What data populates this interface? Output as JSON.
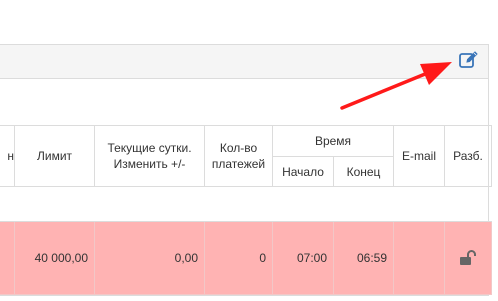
{
  "toolbar": {
    "edit_icon": "edit-icon"
  },
  "table": {
    "columns": {
      "partial": "н",
      "limit": "Лимит",
      "current_day": "Текущие сутки. Изменить +/-",
      "payments_count": "Кол-во платежей",
      "time": "Время",
      "time_start": "Начало",
      "time_end": "Конец",
      "email": "E-mail",
      "unlock": "Разб."
    },
    "row": {
      "limit": "40 000,00",
      "current_day": "0,00",
      "payments_count": "0",
      "time_start": "07:00",
      "time_end": "06:59",
      "email": "",
      "unlock_icon": "unlock-icon"
    }
  },
  "colors": {
    "row_highlight": "#ffb3b3",
    "arrow": "#ff1a1a",
    "icon": "#3a75b8"
  }
}
